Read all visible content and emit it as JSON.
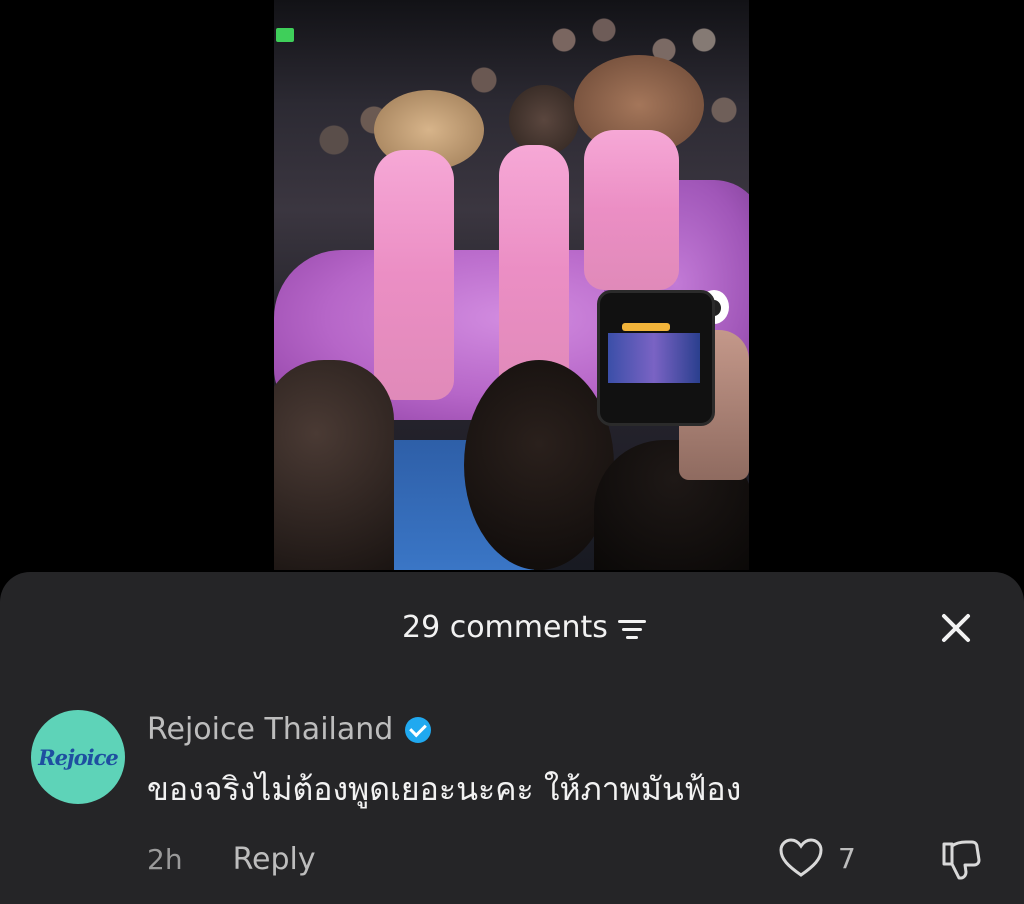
{
  "comments_panel": {
    "title": "29 comments",
    "sort_icon": "sort-lines-icon",
    "close_icon": "close-icon"
  },
  "comment": {
    "author": "Rejoice Thailand",
    "verified": true,
    "avatar_text": "Rejoice",
    "avatar_color": "#5ed3b8",
    "text": "ของจริงไม่ต้องพูดเยอะนะคะ ให้ภาพมันฟ้อง",
    "timestamp": "2h",
    "reply_label": "Reply",
    "like_count": "7",
    "like_icon": "heart-icon",
    "dislike_icon": "thumbs-down-icon"
  },
  "colors": {
    "sheet_bg": "#252527",
    "verified_badge": "#20a9f0",
    "text_primary": "#f2f2f2",
    "text_secondary": "#bdbdbd"
  }
}
